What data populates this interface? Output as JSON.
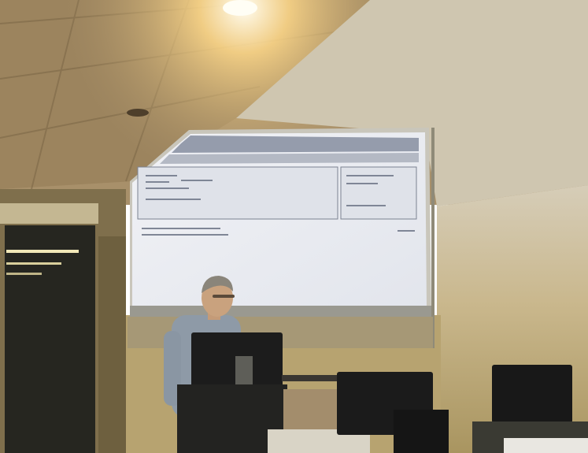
{
  "scene": {
    "description_visible_text": "",
    "colors": {
      "ceiling": "#a8906a",
      "ceiling_dark": "#6e5a3e",
      "wall_left": "#8a7a55",
      "wall_right": "#b9a676",
      "wall_right_upper": "#cfc4ad",
      "screen": "#eceef3",
      "screen_border": "#9ea2a8",
      "slide_header": "#8e96a6",
      "doorway": "#2a2a22",
      "light": "#fff6d6",
      "monitor": "#1c1c1c",
      "shirt": "#8d9aa8",
      "skin": "#c8a07c"
    },
    "icons": [
      "ceiling-light-icon",
      "ceiling-vent-icon"
    ]
  }
}
